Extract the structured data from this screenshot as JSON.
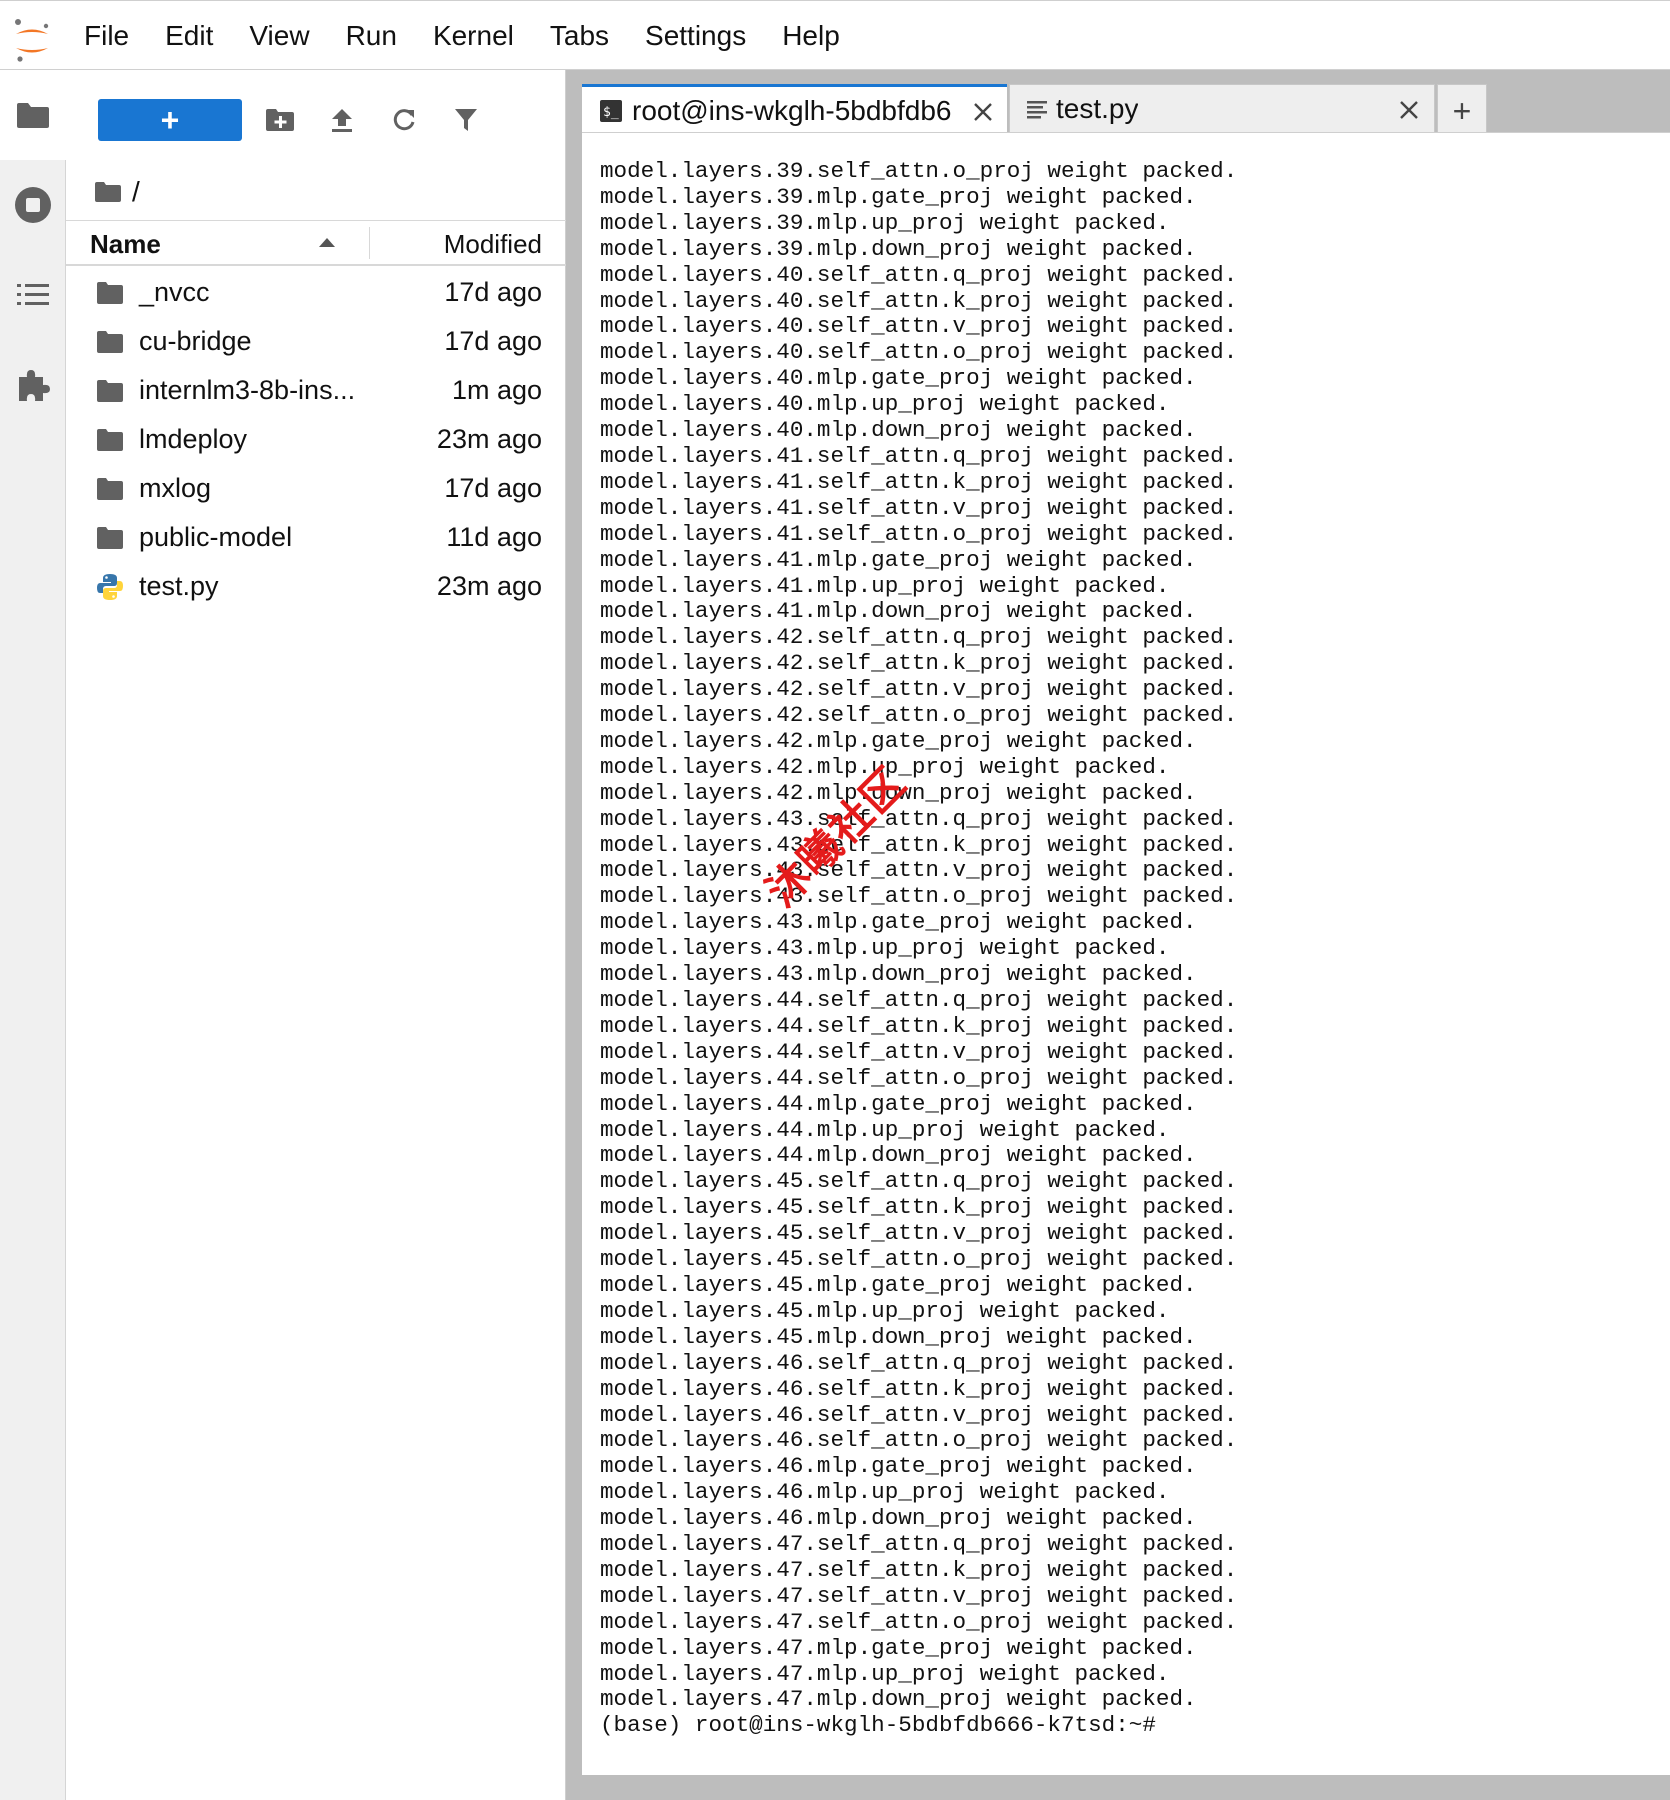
{
  "menubar": {
    "items": [
      "File",
      "Edit",
      "View",
      "Run",
      "Kernel",
      "Tabs",
      "Settings",
      "Help"
    ]
  },
  "activity_bar": {
    "items": [
      "folder-icon",
      "running-icon",
      "toc-icon",
      "extension-icon"
    ]
  },
  "file_browser": {
    "new_button_label": "+",
    "breadcrumb": "/",
    "columns": {
      "name": "Name",
      "modified": "Modified"
    },
    "files": [
      {
        "name": "_nvcc",
        "modified": "17d ago",
        "type": "folder"
      },
      {
        "name": "cu-bridge",
        "modified": "17d ago",
        "type": "folder"
      },
      {
        "name": "internlm3-8b-ins...",
        "modified": "1m ago",
        "type": "folder"
      },
      {
        "name": "lmdeploy",
        "modified": "23m ago",
        "type": "folder"
      },
      {
        "name": "mxlog",
        "modified": "17d ago",
        "type": "folder"
      },
      {
        "name": "public-model",
        "modified": "11d ago",
        "type": "folder"
      },
      {
        "name": "test.py",
        "modified": "23m ago",
        "type": "python"
      }
    ]
  },
  "tabs": {
    "terminal_label": "root@ins-wkglh-5bdbfdb6",
    "testpy_label": "test.py",
    "add_label": "+"
  },
  "terminal": {
    "lines": [
      "model.layers.39.self_attn.o_proj weight packed.",
      "model.layers.39.mlp.gate_proj weight packed.",
      "model.layers.39.mlp.up_proj weight packed.",
      "model.layers.39.mlp.down_proj weight packed.",
      "model.layers.40.self_attn.q_proj weight packed.",
      "model.layers.40.self_attn.k_proj weight packed.",
      "model.layers.40.self_attn.v_proj weight packed.",
      "model.layers.40.self_attn.o_proj weight packed.",
      "model.layers.40.mlp.gate_proj weight packed.",
      "model.layers.40.mlp.up_proj weight packed.",
      "model.layers.40.mlp.down_proj weight packed.",
      "model.layers.41.self_attn.q_proj weight packed.",
      "model.layers.41.self_attn.k_proj weight packed.",
      "model.layers.41.self_attn.v_proj weight packed.",
      "model.layers.41.self_attn.o_proj weight packed.",
      "model.layers.41.mlp.gate_proj weight packed.",
      "model.layers.41.mlp.up_proj weight packed.",
      "model.layers.41.mlp.down_proj weight packed.",
      "model.layers.42.self_attn.q_proj weight packed.",
      "model.layers.42.self_attn.k_proj weight packed.",
      "model.layers.42.self_attn.v_proj weight packed.",
      "model.layers.42.self_attn.o_proj weight packed.",
      "model.layers.42.mlp.gate_proj weight packed.",
      "model.layers.42.mlp.up_proj weight packed.",
      "model.layers.42.mlp.down_proj weight packed.",
      "model.layers.43.self_attn.q_proj weight packed.",
      "model.layers.43.self_attn.k_proj weight packed.",
      "model.layers.43.self_attn.v_proj weight packed.",
      "model.layers.43.self_attn.o_proj weight packed.",
      "model.layers.43.mlp.gate_proj weight packed.",
      "model.layers.43.mlp.up_proj weight packed.",
      "model.layers.43.mlp.down_proj weight packed.",
      "model.layers.44.self_attn.q_proj weight packed.",
      "model.layers.44.self_attn.k_proj weight packed.",
      "model.layers.44.self_attn.v_proj weight packed.",
      "model.layers.44.self_attn.o_proj weight packed.",
      "model.layers.44.mlp.gate_proj weight packed.",
      "model.layers.44.mlp.up_proj weight packed.",
      "model.layers.44.mlp.down_proj weight packed.",
      "model.layers.45.self_attn.q_proj weight packed.",
      "model.layers.45.self_attn.k_proj weight packed.",
      "model.layers.45.self_attn.v_proj weight packed.",
      "model.layers.45.self_attn.o_proj weight packed.",
      "model.layers.45.mlp.gate_proj weight packed.",
      "model.layers.45.mlp.up_proj weight packed.",
      "model.layers.45.mlp.down_proj weight packed.",
      "model.layers.46.self_attn.q_proj weight packed.",
      "model.layers.46.self_attn.k_proj weight packed.",
      "model.layers.46.self_attn.v_proj weight packed.",
      "model.layers.46.self_attn.o_proj weight packed.",
      "model.layers.46.mlp.gate_proj weight packed.",
      "model.layers.46.mlp.up_proj weight packed.",
      "model.layers.46.mlp.down_proj weight packed.",
      "model.layers.47.self_attn.q_proj weight packed.",
      "model.layers.47.self_attn.k_proj weight packed.",
      "model.layers.47.self_attn.v_proj weight packed.",
      "model.layers.47.self_attn.o_proj weight packed.",
      "model.layers.47.mlp.gate_proj weight packed.",
      "model.layers.47.mlp.up_proj weight packed.",
      "model.layers.47.mlp.down_proj weight packed.",
      "(base) root@ins-wkglh-5bdbfdb666-k7tsd:~#"
    ],
    "watermark": "沐曦社区"
  },
  "colors": {
    "accent": "#1976d2",
    "logo": "#f37726",
    "watermark": "#e41b1b",
    "dock_background": "#bdbdbd"
  }
}
